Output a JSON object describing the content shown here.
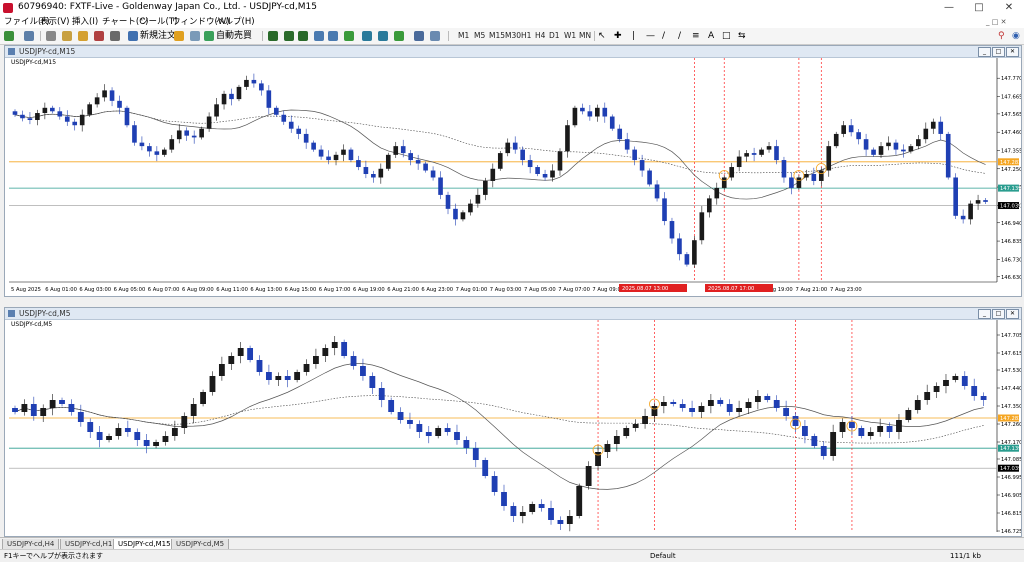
{
  "window": {
    "title": "60796940: FXTF-Live - Goldenway Japan Co., Ltd. - USDJPY-cd,M15"
  },
  "menu": [
    "ファイル(F)",
    "表示(V)",
    "挿入(I)",
    "チャート(C)",
    "ツール(T)",
    "ウィンドウ(W)",
    "ヘルプ(H)"
  ],
  "toolbar": {
    "new_order": "新規注文",
    "auto_trading": "自動売買",
    "timeframes": [
      "M1",
      "M5",
      "M15",
      "M30",
      "H1",
      "H4",
      "D1",
      "W1",
      "MN"
    ]
  },
  "colors": {
    "bull": "#1a1a1a",
    "bear": "#1f3fb3",
    "orange_line": "#f5a623",
    "teal_line": "#2a9d8f",
    "red_marker": "#ff2020",
    "price_label": "#000000"
  },
  "chart_data": [
    {
      "type": "candlestick",
      "title": "USDJPY-cd,M15",
      "symbol_label": "USDJPY-cd,M15",
      "ylim": [
        146.6,
        147.84
      ],
      "y_ticks": [
        147.77,
        147.665,
        147.565,
        147.46,
        147.355,
        147.25,
        147.145,
        147.04,
        146.94,
        146.835,
        146.73,
        146.63
      ],
      "x_ticks": [
        "5 Aug 2025",
        "6 Aug 01:00",
        "6 Aug 03:00",
        "6 Aug 05:00",
        "6 Aug 07:00",
        "6 Aug 09:00",
        "6 Aug 11:00",
        "6 Aug 13:00",
        "6 Aug 15:00",
        "6 Aug 17:00",
        "6 Aug 19:00",
        "6 Aug 21:00",
        "6 Aug 23:00",
        "7 Aug 01:00",
        "7 Aug 03:00",
        "7 Aug 05:00",
        "7 Aug 07:00",
        "7 Aug 09:00",
        "7 Aug 19:00",
        "7 Aug 21:00",
        "7 Aug 23:00"
      ],
      "marker_labels": [
        "2025.08.07 13:00",
        "2025.08.07 17:00"
      ],
      "lines": {
        "orange": 147.29,
        "teal": 147.139,
        "gray": 147.039
      },
      "price_labels": [
        "147.283",
        "147.139",
        "147.039"
      ],
      "closes": [
        147.56,
        147.54,
        147.53,
        147.57,
        147.6,
        147.58,
        147.55,
        147.52,
        147.5,
        147.56,
        147.62,
        147.66,
        147.7,
        147.64,
        147.6,
        147.5,
        147.4,
        147.38,
        147.35,
        147.33,
        147.36,
        147.42,
        147.47,
        147.44,
        147.43,
        147.48,
        147.55,
        147.62,
        147.68,
        147.65,
        147.72,
        147.76,
        147.74,
        147.7,
        147.6,
        147.56,
        147.52,
        147.48,
        147.45,
        147.4,
        147.36,
        147.32,
        147.3,
        147.33,
        147.36,
        147.3,
        147.26,
        147.22,
        147.2,
        147.25,
        147.33,
        147.38,
        147.34,
        147.3,
        147.28,
        147.24,
        147.2,
        147.1,
        147.02,
        146.96,
        147.0,
        147.05,
        147.1,
        147.18,
        147.25,
        147.34,
        147.4,
        147.36,
        147.3,
        147.26,
        147.22,
        147.2,
        147.24,
        147.35,
        147.5,
        147.6,
        147.58,
        147.55,
        147.6,
        147.55,
        147.48,
        147.42,
        147.36,
        147.3,
        147.24,
        147.16,
        147.08,
        146.95,
        146.85,
        146.76,
        146.7,
        146.84,
        147.0,
        147.08,
        147.14,
        147.2,
        147.26,
        147.32,
        147.34,
        147.33,
        147.36,
        147.38,
        147.3,
        147.2,
        147.14,
        147.2,
        147.22,
        147.18,
        147.24,
        147.38,
        147.45,
        147.5,
        147.46,
        147.42,
        147.36,
        147.33,
        147.38,
        147.4,
        147.36,
        147.35,
        147.38,
        147.42,
        147.48,
        147.52,
        147.45,
        147.2,
        146.98,
        146.96,
        147.05,
        147.07,
        147.06
      ]
    },
    {
      "type": "candlestick",
      "title": "USDJPY-cd,M5",
      "symbol_label": "USDJPY-cd,M5",
      "ylim": [
        146.72,
        147.74
      ],
      "y_ticks": [
        147.705,
        147.615,
        147.53,
        147.44,
        147.35,
        147.26,
        147.17,
        147.085,
        146.995,
        146.905,
        146.815,
        146.725
      ],
      "lines": {
        "orange": 147.29,
        "teal": 147.139,
        "gray": 147.039
      },
      "price_labels": [
        "147.283",
        "147.139",
        "147.039"
      ],
      "closes": [
        147.32,
        147.36,
        147.3,
        147.34,
        147.38,
        147.36,
        147.32,
        147.27,
        147.22,
        147.18,
        147.2,
        147.24,
        147.22,
        147.18,
        147.15,
        147.17,
        147.2,
        147.24,
        147.3,
        147.36,
        147.42,
        147.5,
        147.56,
        147.6,
        147.64,
        147.58,
        147.52,
        147.48,
        147.5,
        147.48,
        147.52,
        147.56,
        147.6,
        147.64,
        147.67,
        147.6,
        147.55,
        147.5,
        147.44,
        147.38,
        147.32,
        147.28,
        147.26,
        147.22,
        147.2,
        147.24,
        147.22,
        147.18,
        147.14,
        147.08,
        147.0,
        146.92,
        146.85,
        146.8,
        146.82,
        146.86,
        146.84,
        146.78,
        146.76,
        146.8,
        146.95,
        147.05,
        147.12,
        147.16,
        147.2,
        147.24,
        147.26,
        147.3,
        147.35,
        147.37,
        147.36,
        147.34,
        147.32,
        147.35,
        147.38,
        147.36,
        147.32,
        147.34,
        147.37,
        147.4,
        147.38,
        147.34,
        147.3,
        147.25,
        147.2,
        147.15,
        147.1,
        147.22,
        147.27,
        147.24,
        147.2,
        147.22,
        147.25,
        147.22,
        147.28,
        147.33,
        147.38,
        147.42,
        147.45,
        147.48,
        147.5,
        147.45,
        147.4,
        147.38
      ]
    }
  ],
  "tabs": [
    "USDJPY-cd,H4",
    "USDJPY-cd,H1",
    "USDJPY-cd,M15",
    "USDJPY-cd,M5"
  ],
  "status": {
    "help": "F1キーでヘルプが表示されます",
    "profile": "Default",
    "traffic": "111/1 kb"
  }
}
